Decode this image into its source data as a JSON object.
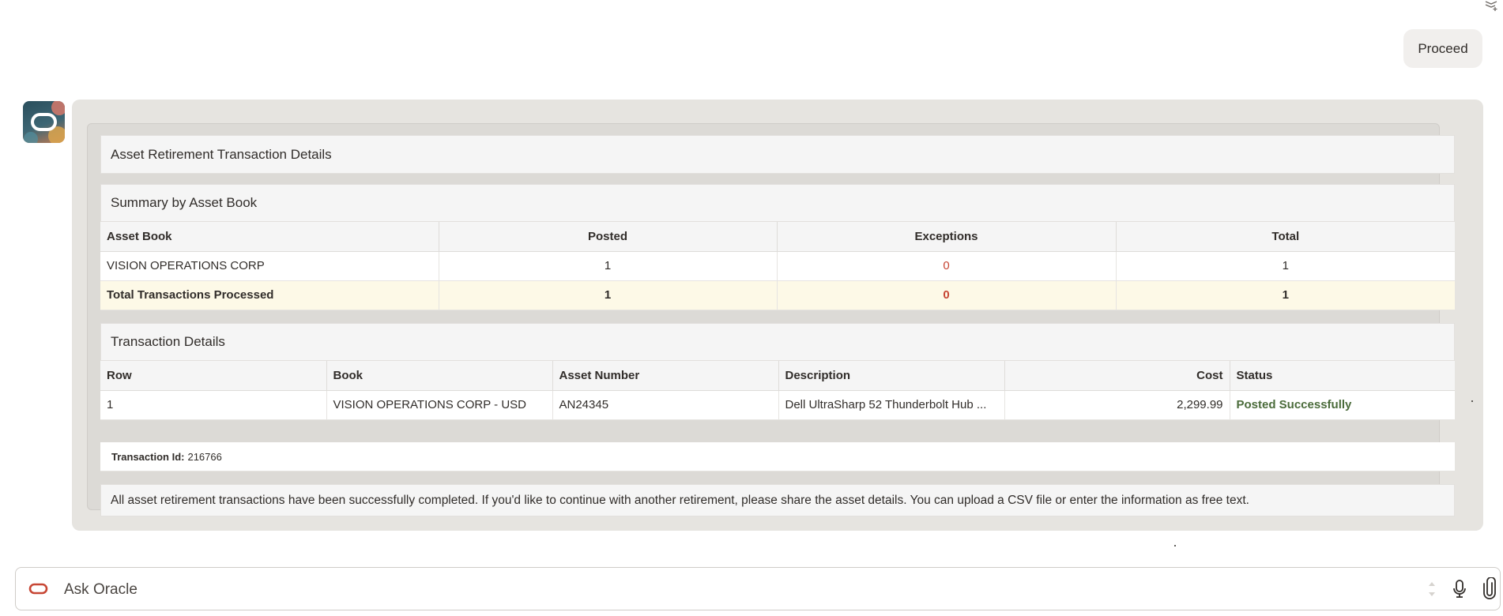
{
  "user_message": {
    "text": "Proceed"
  },
  "report": {
    "title": "Asset Retirement Transaction Details",
    "summary": {
      "heading": "Summary by Asset Book",
      "columns": [
        "Asset Book",
        "Posted",
        "Exceptions",
        "Total"
      ],
      "rows": [
        {
          "asset_book": "VISION OPERATIONS CORP",
          "posted": "1",
          "exceptions": "0",
          "total": "1"
        }
      ],
      "totals": {
        "label": "Total Transactions Processed",
        "posted": "1",
        "exceptions": "0",
        "total": "1"
      }
    },
    "details": {
      "heading": "Transaction Details",
      "columns": [
        "Row",
        "Book",
        "Asset Number",
        "Description",
        "Cost",
        "Status"
      ],
      "rows": [
        {
          "row": "1",
          "book": "VISION OPERATIONS CORP - USD",
          "asset_number": "AN24345",
          "description": "Dell UltraSharp 52 Thunderbolt Hub ...",
          "cost": "2,299.99",
          "status": "Posted Successfully"
        }
      ],
      "transaction_id_label": "Transaction Id:",
      "transaction_id": "216766"
    },
    "footer_note": "All asset retirement transactions have been successfully completed. If you'd like to continue with another retirement, please share the asset details. You can upload a CSV file or enter the information as free text."
  },
  "input_bar": {
    "placeholder": "Ask Oracle"
  },
  "icons": {
    "assistant_avatar": "oracle-avatar-icon",
    "input_logo": "oracle-logo-icon",
    "mic": "microphone-icon",
    "attach": "paperclip-icon",
    "corner": "stack-icon"
  },
  "colors": {
    "accent_red": "#c74634",
    "status_green": "#4a6b3a",
    "total_row_bg": "#fdf9e7"
  }
}
